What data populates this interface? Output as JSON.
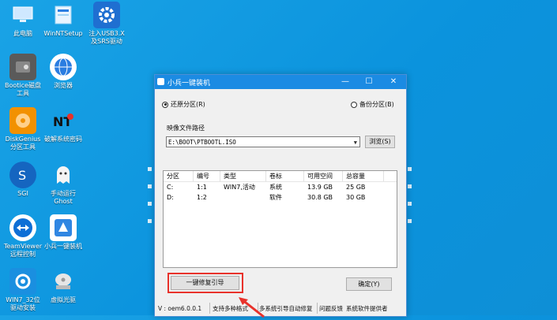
{
  "desktop": {
    "icons": [
      {
        "label": "此电脑",
        "icon": "computer-icon",
        "color": "#cfe8ff"
      },
      {
        "label": "WinNTSetup",
        "icon": "setup-icon",
        "color": "#9fd3f5"
      },
      {
        "label": "注入USB3.X\n及SRS驱动",
        "icon": "gear-icon",
        "color": "#1f6fd1"
      },
      {
        "label": "Bootice磁盘\n工具",
        "icon": "disk-icon",
        "color": "#555"
      },
      {
        "label": "浏览器",
        "icon": "browser-icon",
        "color": "#2a7de1"
      },
      {
        "label": "DiskGenius\n分区工具",
        "icon": "diskgenius-icon",
        "color": "#f29100"
      },
      {
        "label": "破解系统密码",
        "icon": "ntpwd-icon",
        "color": "#222"
      },
      {
        "label": "SGI",
        "icon": "sgi-icon",
        "color": "#1565c0"
      },
      {
        "label": "手动运行\nGhost",
        "icon": "ghost-icon",
        "color": "#f4f4f4"
      },
      {
        "label": "TeamViewer\n远程控制",
        "icon": "teamviewer-icon",
        "color": "#0e6fd6"
      },
      {
        "label": "小兵一键装机",
        "icon": "installer-icon",
        "color": "#2f86e2"
      },
      {
        "label": "WIN7_32位\n驱动安装",
        "icon": "driver-icon",
        "color": "#1a8fe0"
      },
      {
        "label": "虚拟光驱",
        "icon": "cdrom-icon",
        "color": "#d9d9d9"
      }
    ]
  },
  "window": {
    "title": "小兵一键装机",
    "minimize": "—",
    "maximize": "☐",
    "close": "✕",
    "radio_restore": "还原分区(R)",
    "radio_backup": "备份分区(B)",
    "image_path_label": "映像文件路径",
    "image_path_value": "E:\\BOOT\\PTBOOTL.ISO",
    "browse_label": "浏览(S)",
    "table": {
      "headers": [
        "分区",
        "编号",
        "类型",
        "卷标",
        "可用空间",
        "总容量"
      ],
      "rows": [
        [
          "C:",
          "1:1",
          "WIN7,活动",
          "系统",
          "13.9 GB",
          "25 GB"
        ],
        [
          "D:",
          "1:2",
          "",
          "软件",
          "30.8 GB",
          "30 GB"
        ]
      ]
    },
    "repair_button": "一键修复引导",
    "ok_button": "确定(Y)",
    "status": {
      "version": "V : oem6.0.0.1",
      "msg1": "支持多种格式",
      "msg2": "多系统引导自动修复",
      "msg3": "问题反馈",
      "msg4": "系统软件提供者"
    }
  },
  "colors": {
    "titlebar": "#1b8be3",
    "highlight": "#e8322b",
    "desktop": "#0b93dd"
  }
}
